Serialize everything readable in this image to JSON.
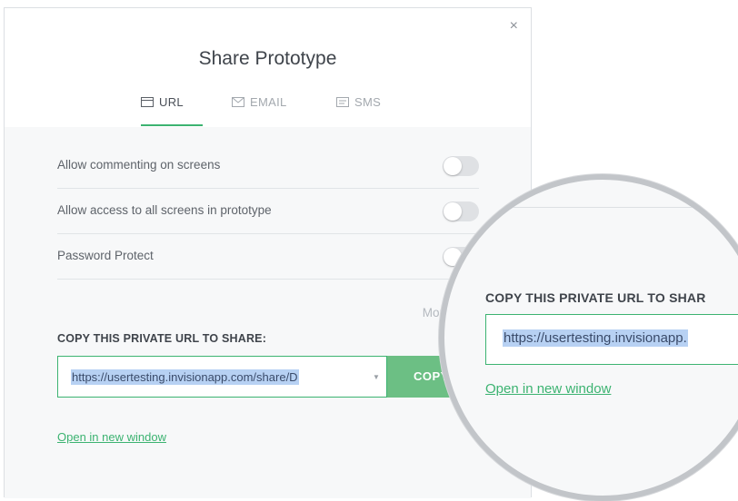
{
  "dialog": {
    "title": "Share Prototype",
    "close_glyph": "×"
  },
  "tabs": [
    {
      "label": "URL",
      "icon": "browser-window-icon",
      "active": true
    },
    {
      "label": "EMAIL",
      "icon": "envelope-icon",
      "active": false
    },
    {
      "label": "SMS",
      "icon": "message-icon",
      "active": false
    }
  ],
  "settings": [
    {
      "label": "Allow commenting on screens",
      "enabled": false
    },
    {
      "label": "Allow access to all screens in prototype",
      "enabled": false
    },
    {
      "label": "Password Protect",
      "enabled": false
    }
  ],
  "more_options_label": "More Opti",
  "share": {
    "copy_label": "COPY THIS PRIVATE URL TO SHARE:",
    "url": "https://usertesting.invisionapp.com/share/D",
    "copy_button_label": "COPY",
    "open_link": "Open in new window"
  },
  "magnifier": {
    "copy_label": "COPY THIS PRIVATE URL TO SHAR",
    "url": "https://usertesting.invisionapp.",
    "open_link": "Open in new window"
  },
  "colors": {
    "accent_green": "#3cb371",
    "button_green": "#6cbf84",
    "selection_blue": "#b7d1f3"
  }
}
